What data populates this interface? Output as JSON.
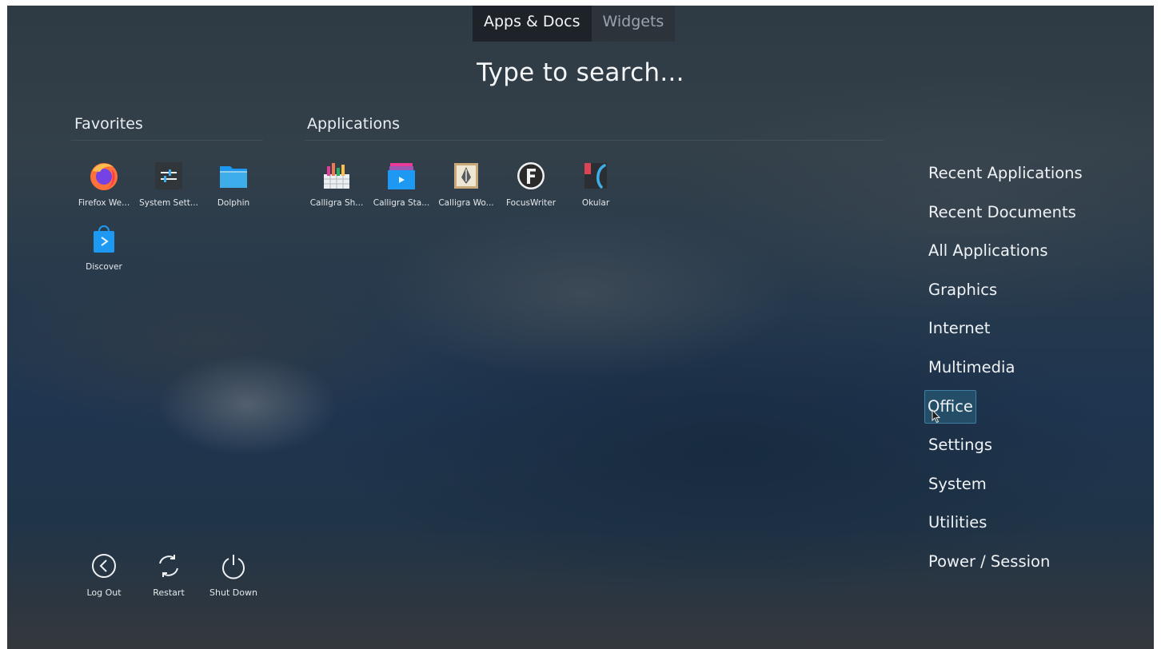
{
  "tabs": [
    {
      "label": "Apps & Docs",
      "active": true
    },
    {
      "label": "Widgets",
      "active": false
    }
  ],
  "search": {
    "placeholder": "Type to search..."
  },
  "favorites": {
    "title": "Favorites",
    "apps": [
      {
        "label": "Firefox We...",
        "icon": "firefox-icon"
      },
      {
        "label": "System Sett...",
        "icon": "system-settings-icon"
      },
      {
        "label": "Dolphin",
        "icon": "dolphin-folder-icon"
      },
      {
        "label": "Discover",
        "icon": "discover-icon"
      }
    ]
  },
  "applications": {
    "title": "Applications",
    "apps": [
      {
        "label": "Calligra Sh...",
        "icon": "calligra-sheets-icon"
      },
      {
        "label": "Calligra Sta...",
        "icon": "calligra-stage-icon"
      },
      {
        "label": "Calligra Wo...",
        "icon": "calligra-words-icon"
      },
      {
        "label": "FocusWriter",
        "icon": "focuswriter-icon"
      },
      {
        "label": "Okular",
        "icon": "okular-icon"
      }
    ]
  },
  "categories": [
    {
      "label": "Recent Applications"
    },
    {
      "label": "Recent Documents"
    },
    {
      "label": "All Applications"
    },
    {
      "label": "Graphics"
    },
    {
      "label": "Internet"
    },
    {
      "label": "Multimedia"
    },
    {
      "label": "Office",
      "selected": true
    },
    {
      "label": "Settings"
    },
    {
      "label": "System"
    },
    {
      "label": "Utilities"
    },
    {
      "label": "Power / Session"
    }
  ],
  "power": [
    {
      "label": "Log Out",
      "icon": "log-out-icon"
    },
    {
      "label": "Restart",
      "icon": "restart-icon"
    },
    {
      "label": "Shut Down",
      "icon": "shut-down-icon"
    }
  ],
  "colors": {
    "selection_bg": "#244e68",
    "selection_border": "#3f7ea3",
    "tab_active_bg": "#1e2329"
  }
}
